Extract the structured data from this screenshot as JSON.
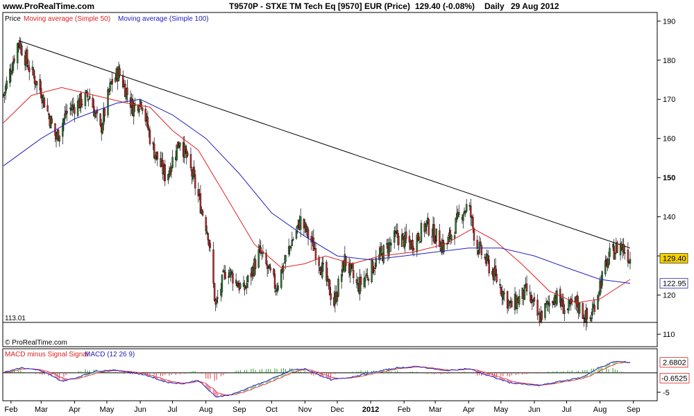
{
  "header": {
    "site": "www.ProRealTime.com",
    "title": "T9570P - STXE TM Tech Eq [9570] EUR (Price)",
    "last": "129.40 (-0.08%)",
    "period": "Daily",
    "date": "29 Aug 2012"
  },
  "legend": {
    "price": "Price",
    "ma50": "Moving average (Simple 50)",
    "ma100": "Moving average (Simple 100)",
    "macd_signal": "MACD minus Signal Signal",
    "macd": "MACD (12 26 9)"
  },
  "copyright": "© ProRealTime.com",
  "colors": {
    "ma50": "#e02020",
    "ma100": "#2020c0",
    "candle_up": "#2e7d32",
    "candle_down": "#c62828",
    "trendline": "#000000",
    "macd_hist_pos": "#2e9e2e",
    "macd_hist_neg": "#d94040",
    "macd_fill_pos": "#a8d8a0",
    "macd_fill_neg": "#f09ab0"
  },
  "chart_data": [
    {
      "type": "candlestick",
      "ylim": [
        107,
        192
      ],
      "y_ticks": [
        110,
        120,
        130,
        140,
        150,
        160,
        170,
        180,
        190
      ],
      "x_tick_labels": [
        "Feb",
        "Mar",
        "Apr",
        "May",
        "Jun",
        "Jul",
        "Aug",
        "Sep",
        "Oct",
        "Nov",
        "Dec",
        "2012",
        "Feb",
        "Mar",
        "Apr",
        "May",
        "Jun",
        "Jul",
        "Aug",
        "Sep"
      ],
      "price_path": [
        {
          "d": "2011-01-25",
          "v": 171
        },
        {
          "d": "2011-02-08",
          "v": 185
        },
        {
          "d": "2011-02-18",
          "v": 178
        },
        {
          "d": "2011-03-01",
          "v": 172
        },
        {
          "d": "2011-03-15",
          "v": 160
        },
        {
          "d": "2011-03-25",
          "v": 167
        },
        {
          "d": "2011-04-15",
          "v": 171
        },
        {
          "d": "2011-04-25",
          "v": 162
        },
        {
          "d": "2011-05-05",
          "v": 174
        },
        {
          "d": "2011-05-12",
          "v": 177
        },
        {
          "d": "2011-05-25",
          "v": 168
        },
        {
          "d": "2011-06-02",
          "v": 170
        },
        {
          "d": "2011-06-12",
          "v": 158
        },
        {
          "d": "2011-06-25",
          "v": 150
        },
        {
          "d": "2011-07-08",
          "v": 160
        },
        {
          "d": "2011-07-20",
          "v": 150
        },
        {
          "d": "2011-08-03",
          "v": 136
        },
        {
          "d": "2011-08-10",
          "v": 117
        },
        {
          "d": "2011-08-20",
          "v": 127
        },
        {
          "d": "2011-09-05",
          "v": 121
        },
        {
          "d": "2011-09-20",
          "v": 131
        },
        {
          "d": "2011-10-05",
          "v": 122
        },
        {
          "d": "2011-10-20",
          "v": 134
        },
        {
          "d": "2011-10-28",
          "v": 139
        },
        {
          "d": "2011-11-10",
          "v": 132
        },
        {
          "d": "2011-11-28",
          "v": 118
        },
        {
          "d": "2011-12-08",
          "v": 129
        },
        {
          "d": "2011-12-20",
          "v": 122
        },
        {
          "d": "2012-01-10",
          "v": 130
        },
        {
          "d": "2012-01-25",
          "v": 135
        },
        {
          "d": "2012-02-08",
          "v": 133
        },
        {
          "d": "2012-02-22",
          "v": 138
        },
        {
          "d": "2012-03-10",
          "v": 132
        },
        {
          "d": "2012-03-25",
          "v": 141
        },
        {
          "d": "2012-04-01",
          "v": 143
        },
        {
          "d": "2012-04-08",
          "v": 133
        },
        {
          "d": "2012-04-25",
          "v": 125
        },
        {
          "d": "2012-05-10",
          "v": 117
        },
        {
          "d": "2012-05-25",
          "v": 121
        },
        {
          "d": "2012-06-05",
          "v": 114
        },
        {
          "d": "2012-06-20",
          "v": 120
        },
        {
          "d": "2012-07-01",
          "v": 116
        },
        {
          "d": "2012-07-10",
          "v": 118
        },
        {
          "d": "2012-07-22",
          "v": 113
        },
        {
          "d": "2012-08-01",
          "v": 123
        },
        {
          "d": "2012-08-10",
          "v": 130
        },
        {
          "d": "2012-08-20",
          "v": 133
        },
        {
          "d": "2012-08-29",
          "v": 129.4
        }
      ],
      "series": [
        {
          "name": "Moving average (Simple 50)",
          "points": [
            {
              "d": "2011-01-25",
              "v": 164
            },
            {
              "d": "2011-02-20",
              "v": 171
            },
            {
              "d": "2011-03-20",
              "v": 173
            },
            {
              "d": "2011-04-20",
              "v": 171
            },
            {
              "d": "2011-05-20",
              "v": 169
            },
            {
              "d": "2011-06-10",
              "v": 168
            },
            {
              "d": "2011-07-01",
              "v": 162
            },
            {
              "d": "2011-07-25",
              "v": 157
            },
            {
              "d": "2011-08-20",
              "v": 145
            },
            {
              "d": "2011-09-15",
              "v": 133
            },
            {
              "d": "2011-10-10",
              "v": 127
            },
            {
              "d": "2011-11-01",
              "v": 128
            },
            {
              "d": "2011-11-20",
              "v": 130
            },
            {
              "d": "2011-12-15",
              "v": 128
            },
            {
              "d": "2012-01-10",
              "v": 130
            },
            {
              "d": "2012-02-10",
              "v": 131
            },
            {
              "d": "2012-03-10",
              "v": 133
            },
            {
              "d": "2012-04-05",
              "v": 137
            },
            {
              "d": "2012-04-25",
              "v": 134
            },
            {
              "d": "2012-05-20",
              "v": 128
            },
            {
              "d": "2012-06-15",
              "v": 121
            },
            {
              "d": "2012-07-10",
              "v": 118
            },
            {
              "d": "2012-08-01",
              "v": 119
            },
            {
              "d": "2012-08-29",
              "v": 124
            }
          ]
        },
        {
          "name": "Moving average (Simple 100)",
          "points": [
            {
              "d": "2011-01-25",
              "v": 153
            },
            {
              "d": "2011-03-01",
              "v": 160
            },
            {
              "d": "2011-04-01",
              "v": 165
            },
            {
              "d": "2011-05-10",
              "v": 169
            },
            {
              "d": "2011-06-01",
              "v": 170
            },
            {
              "d": "2011-07-01",
              "v": 166
            },
            {
              "d": "2011-08-01",
              "v": 160
            },
            {
              "d": "2011-09-01",
              "v": 151
            },
            {
              "d": "2011-10-01",
              "v": 141
            },
            {
              "d": "2011-11-01",
              "v": 135
            },
            {
              "d": "2011-12-01",
              "v": 130
            },
            {
              "d": "2012-01-01",
              "v": 129
            },
            {
              "d": "2012-02-01",
              "v": 130
            },
            {
              "d": "2012-03-01",
              "v": 131
            },
            {
              "d": "2012-04-01",
              "v": 132
            },
            {
              "d": "2012-05-01",
              "v": 132
            },
            {
              "d": "2012-06-01",
              "v": 130
            },
            {
              "d": "2012-07-01",
              "v": 127
            },
            {
              "d": "2012-08-01",
              "v": 124
            },
            {
              "d": "2012-08-29",
              "v": 123
            }
          ]
        }
      ],
      "trendline": [
        {
          "d": "2011-02-08",
          "v": 185
        },
        {
          "d": "2012-08-29",
          "v": 132
        }
      ],
      "support": {
        "v": 113.01,
        "label": "113.01"
      },
      "last_price_label": "129.40",
      "ma100_label": "122.95",
      "ma50_label_hidden": "123.9"
    },
    {
      "type": "macd",
      "ylim": [
        -7,
        6
      ],
      "y_ticks": [
        -5
      ],
      "labels": {
        "macd": "2.6802",
        "signal_diff": "-0.6525"
      },
      "points": [
        {
          "d": "2011-01-25",
          "v": 0.2
        },
        {
          "d": "2011-02-10",
          "v": 1.3
        },
        {
          "d": "2011-02-25",
          "v": 0.8
        },
        {
          "d": "2011-03-10",
          "v": -0.6
        },
        {
          "d": "2011-03-20",
          "v": -2.2
        },
        {
          "d": "2011-04-01",
          "v": -1.4
        },
        {
          "d": "2011-04-20",
          "v": 0.4
        },
        {
          "d": "2011-05-05",
          "v": 0.7
        },
        {
          "d": "2011-05-20",
          "v": 0.3
        },
        {
          "d": "2011-06-05",
          "v": -0.5
        },
        {
          "d": "2011-06-25",
          "v": -2.4
        },
        {
          "d": "2011-07-10",
          "v": -2.8
        },
        {
          "d": "2011-07-25",
          "v": -1.9
        },
        {
          "d": "2011-08-10",
          "v": -6.2
        },
        {
          "d": "2011-08-25",
          "v": -5.6
        },
        {
          "d": "2011-09-15",
          "v": -3.3
        },
        {
          "d": "2011-10-01",
          "v": -1.6
        },
        {
          "d": "2011-10-20",
          "v": 0.8
        },
        {
          "d": "2011-11-01",
          "v": 1.0
        },
        {
          "d": "2011-11-25",
          "v": -1.8
        },
        {
          "d": "2011-12-10",
          "v": -1.3
        },
        {
          "d": "2012-01-05",
          "v": 0.2
        },
        {
          "d": "2012-01-25",
          "v": 1.3
        },
        {
          "d": "2012-02-15",
          "v": 1.6
        },
        {
          "d": "2012-03-10",
          "v": 0.5
        },
        {
          "d": "2012-04-01",
          "v": 1.1
        },
        {
          "d": "2012-04-20",
          "v": -0.8
        },
        {
          "d": "2012-05-10",
          "v": -2.6
        },
        {
          "d": "2012-06-05",
          "v": -3.3
        },
        {
          "d": "2012-06-25",
          "v": -2.2
        },
        {
          "d": "2012-07-15",
          "v": -1.2
        },
        {
          "d": "2012-08-01",
          "v": 1.4
        },
        {
          "d": "2012-08-15",
          "v": 2.9
        },
        {
          "d": "2012-08-29",
          "v": 2.68
        }
      ]
    }
  ]
}
